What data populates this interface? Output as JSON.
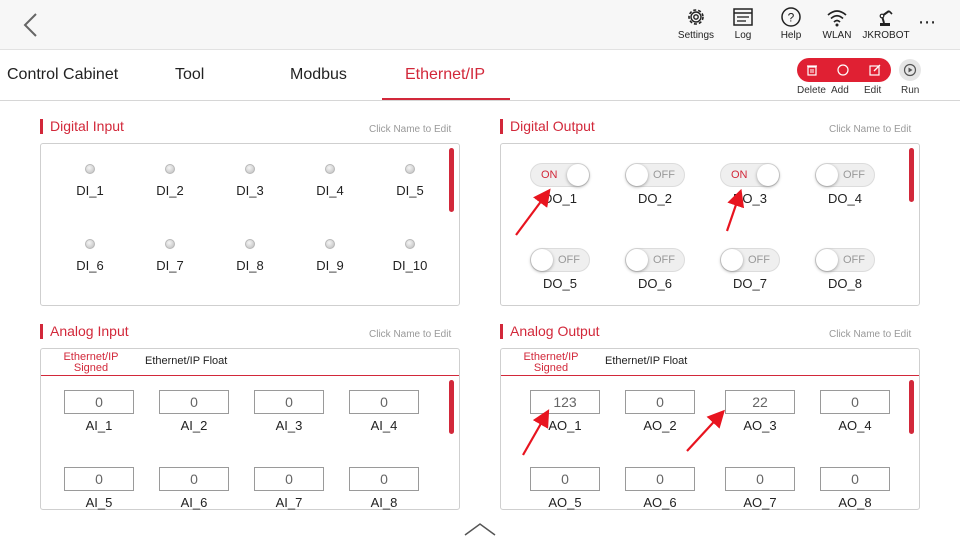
{
  "header": {
    "tools": [
      {
        "icon": "settings-gear-icon",
        "label": "Settings"
      },
      {
        "icon": "log-icon",
        "label": "Log"
      },
      {
        "icon": "help-icon",
        "label": "Help"
      },
      {
        "icon": "wlan-icon",
        "label": "WLAN"
      },
      {
        "icon": "robot-arm-icon",
        "label": "JKROBOT"
      }
    ],
    "more_glyph": "⋯"
  },
  "tabs": [
    "Control Cabinet",
    "Tool",
    "Modbus",
    "Ethernet/IP"
  ],
  "active_tab": "Ethernet/IP",
  "actions": [
    "Delete",
    "Add",
    "Edit",
    "Run"
  ],
  "digital_input": {
    "title": "Digital Input",
    "hint": "Click Name to Edit",
    "items": [
      "DI_1",
      "DI_2",
      "DI_3",
      "DI_4",
      "DI_5",
      "DI_6",
      "DI_7",
      "DI_8",
      "DI_9",
      "DI_10"
    ]
  },
  "digital_output": {
    "title": "Digital Output",
    "hint": "Click Name to Edit",
    "items": [
      {
        "name": "DO_1",
        "state": "ON"
      },
      {
        "name": "DO_2",
        "state": "OFF"
      },
      {
        "name": "DO_3",
        "state": "ON"
      },
      {
        "name": "DO_4",
        "state": "OFF"
      },
      {
        "name": "DO_5",
        "state": "OFF"
      },
      {
        "name": "DO_6",
        "state": "OFF"
      },
      {
        "name": "DO_7",
        "state": "OFF"
      },
      {
        "name": "DO_8",
        "state": "OFF"
      }
    ]
  },
  "analog_input": {
    "title": "Analog Input",
    "hint": "Click Name to Edit",
    "subtabs": [
      "Ethernet/IP Signed",
      "Ethernet/IP Float"
    ],
    "items": [
      {
        "name": "AI_1",
        "value": "0"
      },
      {
        "name": "AI_2",
        "value": "0"
      },
      {
        "name": "AI_3",
        "value": "0"
      },
      {
        "name": "AI_4",
        "value": "0"
      },
      {
        "name": "AI_5",
        "value": "0"
      },
      {
        "name": "AI_6",
        "value": "0"
      },
      {
        "name": "AI_7",
        "value": "0"
      },
      {
        "name": "AI_8",
        "value": "0"
      }
    ]
  },
  "analog_output": {
    "title": "Analog Output",
    "hint": "Click Name to Edit",
    "subtabs": [
      "Ethernet/IP Signed",
      "Ethernet/IP Float"
    ],
    "items": [
      {
        "name": "AO_1",
        "value": "123"
      },
      {
        "name": "AO_2",
        "value": "0"
      },
      {
        "name": "AO_3",
        "value": "22"
      },
      {
        "name": "AO_4",
        "value": "0"
      },
      {
        "name": "AO_5",
        "value": "0"
      },
      {
        "name": "AO_6",
        "value": "0"
      },
      {
        "name": "AO_7",
        "value": "0"
      },
      {
        "name": "AO_8",
        "value": "0"
      }
    ]
  },
  "colors": {
    "accent": "#d2283a",
    "action_pill": "#e02033"
  }
}
